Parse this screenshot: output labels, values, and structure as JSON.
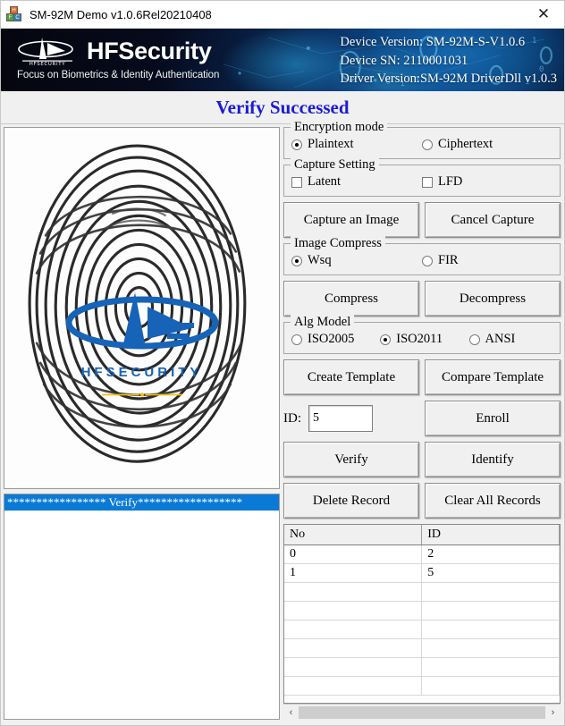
{
  "window": {
    "title": "SM-92M Demo v1.0.6Rel20210408",
    "close_label": "✕",
    "icon": "app-blocks-icon"
  },
  "banner": {
    "brand": "HFSecurity",
    "tagline": "Focus on Biometrics & Identity Authentication",
    "logo_word": "HFSECURITY",
    "device_version": "Device Version: SM-92M-S-V1.0.6",
    "device_sn": "Device SN: 2110001031",
    "driver_version": "Driver Version:SM-92M DriverDll v1.0.3"
  },
  "status": {
    "message": "Verify Successed",
    "color": "#1b1bd6"
  },
  "fingerprint": {
    "watermark_text": "HFSECURITY",
    "watermark_color": "#1663b8",
    "accent_color": "#f2c00a"
  },
  "log": {
    "selected_line": "***************** Verify******************",
    "selected_bg": "#0b7ad6"
  },
  "encryption": {
    "legend": "Encryption mode",
    "options": [
      {
        "label": "Plaintext",
        "selected": true
      },
      {
        "label": "Ciphertext",
        "selected": false
      }
    ]
  },
  "capture_setting": {
    "legend": "Capture Setting",
    "options": [
      {
        "label": "Latent",
        "checked": false
      },
      {
        "label": "LFD",
        "checked": false
      }
    ]
  },
  "capture_buttons": {
    "capture": "Capture an Image",
    "cancel": "Cancel Capture"
  },
  "image_compress": {
    "legend": "Image Compress",
    "options": [
      {
        "label": "Wsq",
        "selected": true
      },
      {
        "label": "FIR",
        "selected": false
      }
    ]
  },
  "compress_buttons": {
    "compress": "Compress",
    "decompress": "Decompress"
  },
  "alg_model": {
    "legend": "Alg Model",
    "options": [
      {
        "label": "ISO2005",
        "selected": false
      },
      {
        "label": "ISO2011",
        "selected": true
      },
      {
        "label": "ANSI",
        "selected": false
      }
    ]
  },
  "template_buttons": {
    "create": "Create Template",
    "compare": "Compare Template"
  },
  "id_row": {
    "label": "ID:",
    "value": "5",
    "placeholder": "",
    "enroll": "Enroll"
  },
  "verify_buttons": {
    "verify": "Verify",
    "identify": "Identify"
  },
  "record_buttons": {
    "delete": "Delete Record",
    "clear": "Clear All Records"
  },
  "records_table": {
    "columns": [
      "No",
      "ID"
    ],
    "rows": [
      {
        "no": "0",
        "id": "2"
      },
      {
        "no": "1",
        "id": "5"
      },
      {
        "no": "",
        "id": ""
      },
      {
        "no": "",
        "id": ""
      },
      {
        "no": "",
        "id": ""
      },
      {
        "no": "",
        "id": ""
      },
      {
        "no": "",
        "id": ""
      },
      {
        "no": "",
        "id": ""
      }
    ]
  },
  "scrollbar": {
    "left_arrow": "‹",
    "right_arrow": "›"
  }
}
